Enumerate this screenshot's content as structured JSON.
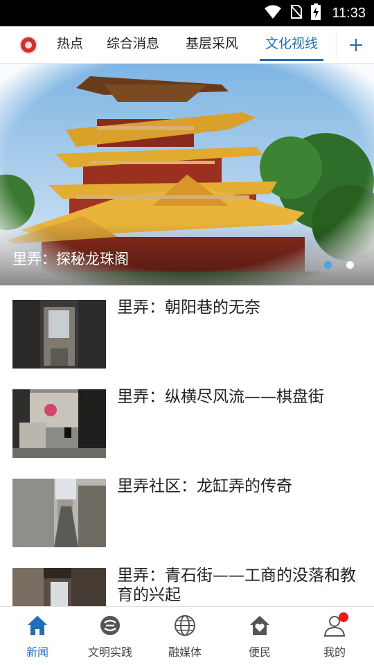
{
  "status_bar": {
    "time": "11:33",
    "icons": [
      "wifi-icon",
      "no-sim-icon",
      "battery-charging-icon"
    ]
  },
  "tab_bar": {
    "logo": "app-logo",
    "tabs": [
      {
        "label": "热点",
        "active": false
      },
      {
        "label": "综合消息",
        "active": false
      },
      {
        "label": "基层采风",
        "active": false
      },
      {
        "label": "文化视线",
        "active": true
      }
    ],
    "more_button_icon": "plus-icon"
  },
  "banner": {
    "caption": "里弄：探秘龙珠阁",
    "slide_count": 2,
    "active_slide": 1
  },
  "news": [
    {
      "title": "里弄：朝阳巷的无奈"
    },
    {
      "title": "里弄：纵横尽风流——棋盘街"
    },
    {
      "title": "里弄社区：龙缸弄的传奇"
    },
    {
      "title": "里弄：青石街——工商的没落和教育的兴起"
    }
  ],
  "bottom_nav": {
    "items": [
      {
        "label": "新闻",
        "icon": "home-icon",
        "active": true
      },
      {
        "label": "文明实践",
        "icon": "practice-icon",
        "active": false
      },
      {
        "label": "融媒体",
        "icon": "globe-icon",
        "active": false
      },
      {
        "label": "便民",
        "icon": "heart-house-icon",
        "active": false
      },
      {
        "label": "我的",
        "icon": "user-icon",
        "active": false,
        "has_notification": true
      }
    ]
  },
  "colors": {
    "accent": "#1e6fb8",
    "status_bar": "#000000",
    "notification": "#f01818",
    "logo": "#d32f2f"
  }
}
